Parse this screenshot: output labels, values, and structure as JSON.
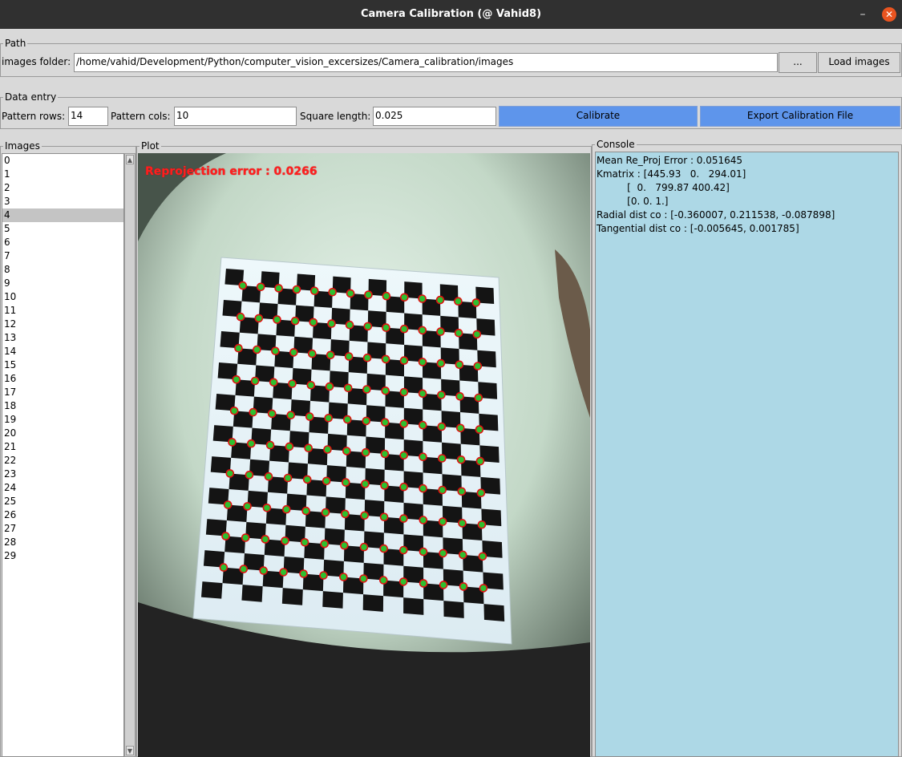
{
  "window": {
    "title": "Camera Calibration (@ Vahid8)",
    "minimize_glyph": "–",
    "close_glyph": "✕"
  },
  "path": {
    "group_label": "Path",
    "folder_label": "images folder:",
    "folder_value": "/home/vahid/Development/Python/computer_vision_excersizes/Camera_calibration/images",
    "browse_label": "...",
    "load_label": "Load images"
  },
  "data_entry": {
    "group_label": "Data entry",
    "rows_label": "Pattern rows:",
    "rows_value": "14",
    "cols_label": "Pattern cols:",
    "cols_value": "10",
    "square_label": "Square length:",
    "square_value": "0.025",
    "calibrate_label": "Calibrate",
    "export_label": "Export Calibration File"
  },
  "images": {
    "group_label": "Images",
    "items": [
      "0",
      "1",
      "2",
      "3",
      "4",
      "5",
      "6",
      "7",
      "8",
      "9",
      "10",
      "11",
      "12",
      "13",
      "14",
      "15",
      "16",
      "17",
      "18",
      "19",
      "20",
      "21",
      "22",
      "23",
      "24",
      "25",
      "26",
      "27",
      "28",
      "29"
    ],
    "selected_index": 4
  },
  "plot": {
    "group_label": "Plot",
    "overlay_text": "Reprojection error : 0.0266"
  },
  "console": {
    "group_label": "Console",
    "lines": [
      "Mean Re_Proj Error : 0.051645",
      "Kmatrix : [445.93   0.   294.01]",
      "          [  0.   799.87 400.42]",
      "          [0. 0. 1.]",
      "Radial dist co : [-0.360007, 0.211538, -0.087898]",
      "Tangential dist co : [-0.005645, 0.001785]"
    ]
  },
  "colors": {
    "accent_button": "#5e95eb",
    "console_bg": "#add8e6",
    "corner_marker_ring": "#e01010",
    "corner_marker_fill": "#2fbf2f",
    "overlay_text": "#ff1e1e"
  }
}
